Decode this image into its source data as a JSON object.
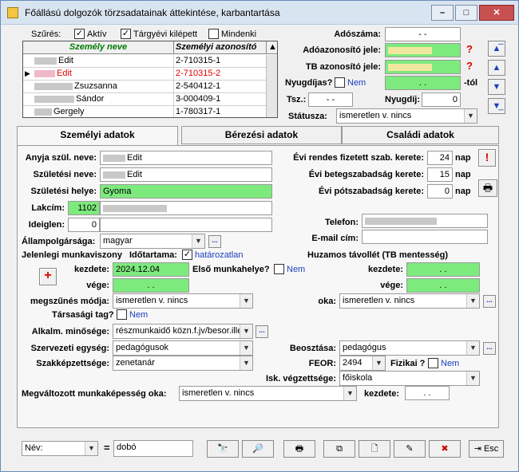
{
  "window": {
    "title": "Főállású dolgozók törzsadatainak áttekintése, karbantartása",
    "min_label": "–",
    "max_label": "□",
    "close_label": "✕"
  },
  "filter": {
    "label": "Szűrés:",
    "aktiv": {
      "label": "Aktív",
      "checked": "✓"
    },
    "targyevi": {
      "label": "Tárgyévi kilépett",
      "checked": "✓"
    },
    "mindenki": {
      "label": "Mindenki",
      "checked": ""
    }
  },
  "grid": {
    "columns": [
      "Személy neve",
      "Személyi azonosító"
    ],
    "rows": [
      {
        "name": "Edit",
        "id": "2-710315-1"
      },
      {
        "name": "Edit",
        "id": "2-710315-2"
      },
      {
        "name": "Zsuzsanna",
        "id": "2-540412-1"
      },
      {
        "name": "Sándor",
        "id": "3-000409-1"
      },
      {
        "name": "Gergely",
        "id": "1-780317-1"
      }
    ],
    "current_marker": "▶"
  },
  "right_top": {
    "adoszama_label": "Adószáma:",
    "adoszama_value": "- -",
    "adoazonosito_label": "Adóazonosító jele:",
    "tb_label": "TB azonosító jele:",
    "nyugdijas_label": "Nyugdíjas?",
    "nyugdijas_value": "Nem",
    "nyugdij_date": ". .",
    "tol": "-tól",
    "tsz_label": "Tsz.:",
    "tsz_value": "- -",
    "nyugdij_label": "Nyugdíj:",
    "nyugdij_value": "0",
    "statusza_label": "Státusza:",
    "statusza_value": "ismeretlen v. nincs",
    "question": "?"
  },
  "tabs": [
    "Személyi adatok",
    "Bérezési adatok",
    "Családi adatok"
  ],
  "personal": {
    "anyja_label": "Anyja szül. neve:",
    "anyja_value": "Edit",
    "szuletesi_nev_label": "Születési neve:",
    "szuletesi_nev_value": "Edit",
    "szuletesi_hely_label": "Születési helye:",
    "szuletesi_hely_value": "Gyoma",
    "lakcim_label": "Lakcím:",
    "lakcim_zip": "1102",
    "ideiglen_label": "Ideiglen:",
    "ideiglen_zip": "0",
    "allampolgarsag_label": "Állampolgársága:",
    "allampolgarsag_value": "magyar",
    "jelenlegi_label": "Jelenlegi munkaviszony",
    "idotartama_label": "Időtartama:",
    "idotartama_value": "határozatlan",
    "kezdete_label": "kezdete:",
    "kezdete_value": "2024.12.04",
    "vege_label": "vége:",
    "vege_value": ". .",
    "elso_munkahely_label": "Első munkahelye?",
    "elso_munkahely_value": "Nem",
    "megszunes_label": "megszűnés módja:",
    "megszunes_value": "ismeretlen v. nincs",
    "tarsasagi_label": "Társasági tag?",
    "tarsasagi_value": "Nem",
    "alkalm_label": "Alkalm. minősége:",
    "alkalm_value": "részmunkaidő közn.f.jv/besor.ille",
    "szervezeti_label": "Szervezeti egység:",
    "szervezeti_value": "pedagógusok",
    "szakkepzettseg_label": "Szakképzettsége:",
    "szakkepzettseg_value": "zenetanár",
    "megvaltozott_label": "Megváltozott munkaképesség oka:",
    "megvaltozott_value": "ismeretlen v. nincs",
    "megvaltozott_kezdete_label": "kezdete:",
    "megvaltozott_kezdete_value": ". .",
    "evi_rendes_label": "Évi rendes fizetett szab. kerete:",
    "evi_rendes_value": "24",
    "evi_beteg_label": "Évi betegszabadság kerete:",
    "evi_beteg_value": "15",
    "evi_potszab_label": "Évi pótszabadság kerete:",
    "evi_potszab_value": "0",
    "nap": "nap",
    "excl": "!",
    "telefon_label": "Telefon:",
    "email_label": "E-mail cím:",
    "huzamos_label": "Huzamos távollét (TB mentesség)",
    "huzamos_kezdete_label": "kezdete:",
    "huzamos_kezdete_value": ". .",
    "huzamos_vege_label": "vége:",
    "huzamos_vege_value": ". .",
    "oka_label": "oka:",
    "oka_value": "ismeretlen v. nincs",
    "beosztasa_label": "Beosztása:",
    "beosztasa_value": "pedagógus",
    "feor_label": "FEOR:",
    "feor_value": "2494",
    "fizikai_label": "Fizikai ?",
    "fizikai_value": "Nem",
    "isk_label": "Isk. végzettsége:",
    "isk_value": "főiskola",
    "plus": "+",
    "dots": "..."
  },
  "bottom": {
    "search_field": "Név:",
    "equals": "=",
    "search_value": "dobó",
    "esc_label": "Esc"
  }
}
